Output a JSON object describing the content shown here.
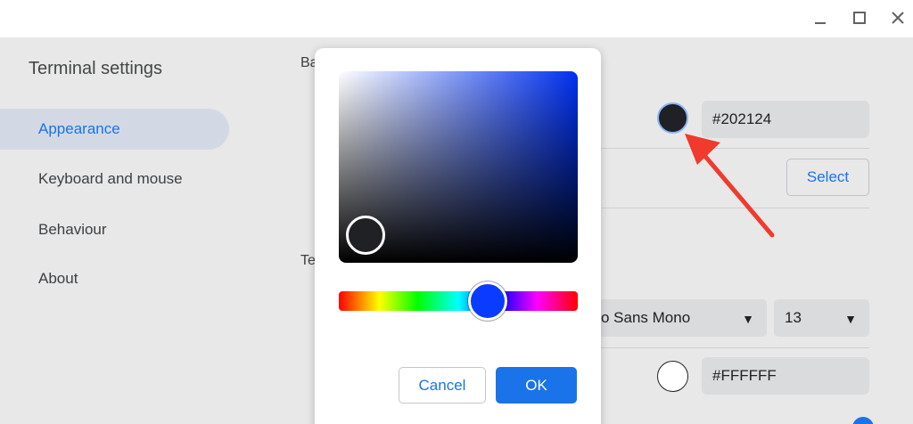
{
  "window": {
    "controls": [
      "minimize",
      "maximize",
      "close"
    ]
  },
  "sidebar": {
    "title": "Terminal settings",
    "items": [
      {
        "label": "Appearance",
        "active": true
      },
      {
        "label": "Keyboard and mouse",
        "active": false
      },
      {
        "label": "Behaviour",
        "active": false
      },
      {
        "label": "About",
        "active": false
      }
    ]
  },
  "content": {
    "section1_partial": "Ba",
    "section2_partial": "Te",
    "background_color_value": "#202124",
    "select_label": "Select",
    "font_family_partial": "o Sans Mono",
    "font_size": "13",
    "text_color_value": "#FFFFFF"
  },
  "picker": {
    "cancel_label": "Cancel",
    "ok_label": "OK"
  },
  "colors": {
    "accent": "#1a73e8",
    "background_swatch": "#202124",
    "text_swatch": "#FFFFFF",
    "annotation_arrow": "#f03a2e"
  }
}
